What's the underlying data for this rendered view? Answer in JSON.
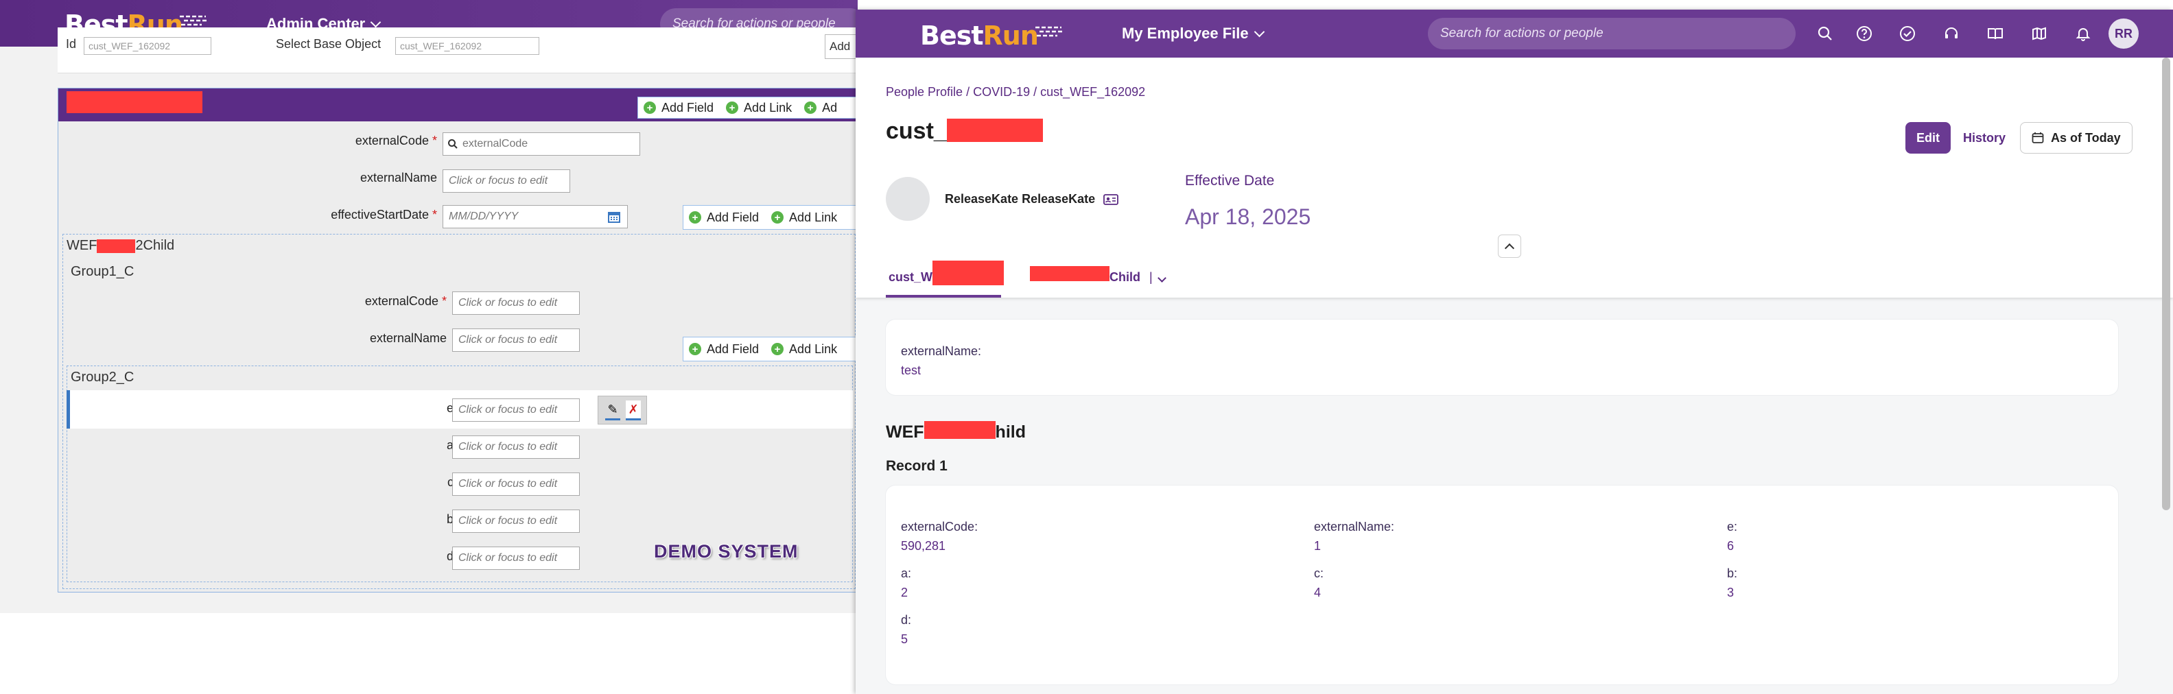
{
  "left": {
    "brand": {
      "best": "Best",
      "run": "Run"
    },
    "shell_title": "Admin Center",
    "search_placeholder": "Search for actions or people",
    "top_label_id": "Id",
    "top_label_base": "Select Base Object",
    "top_id_value": "cust_WEF_162092",
    "top_base_value": "cust_WEF_162092",
    "top_cut_button": "Add",
    "toolbar1": {
      "add_field": "Add Field",
      "add_link": "Add Link",
      "add_cut": "Ad"
    },
    "fields_top": [
      {
        "label": "externalCode",
        "required": true,
        "placeholder": "externalCode"
      },
      {
        "label": "externalName",
        "required": false,
        "placeholder": "Click or focus to edit"
      },
      {
        "label": "effectiveStartDate",
        "required": true,
        "placeholder": "MM/DD/YYYY"
      }
    ],
    "toolbar2": {
      "add_field": "Add Field",
      "add_link": "Add Link"
    },
    "child_section": {
      "prefix": "WEF",
      "suffix": "2Child"
    },
    "group1": "Group1_C",
    "group1_fields": [
      {
        "label": "externalCode",
        "required": true,
        "placeholder": "Click or focus to edit"
      },
      {
        "label": "externalName",
        "required": false,
        "placeholder": "Click or focus to edit"
      }
    ],
    "toolbar3": {
      "add_field": "Add Field",
      "add_link": "Add Link"
    },
    "group2": "Group2_C",
    "group2_fields": [
      {
        "label": "e",
        "placeholder": "Click or focus to edit"
      },
      {
        "label": "a",
        "placeholder": "Click or focus to edit"
      },
      {
        "label": "c",
        "placeholder": "Click or focus to edit"
      },
      {
        "label": "b",
        "placeholder": "Click or focus to edit"
      },
      {
        "label": "d",
        "placeholder": "Click or focus to edit"
      }
    ],
    "demo_system": "DEMO SYSTEM"
  },
  "right": {
    "brand": {
      "best": "Best",
      "run": "Run"
    },
    "shell_title": "My Employee File",
    "search_placeholder": "Search for actions or people",
    "avatar_initials": "RR",
    "breadcrumb": "People Profile / COVID-19 / cust_WEF_162092",
    "title_prefix": "cust_",
    "edit": "Edit",
    "history": "History",
    "as_of_today": "As of Today",
    "person_name": "ReleaseKate ReleaseKate",
    "effective_date_label": "Effective Date",
    "effective_date_value": "Apr 18, 2025",
    "tab1_prefix": "cust_W",
    "tab2_suffix": "Child",
    "tab_more": "|",
    "external_name_label": "externalName:",
    "external_name_value": "test",
    "child_head_prefix": "WEF",
    "child_head_suffix": "hild",
    "record_title": "Record 1",
    "record": [
      {
        "label": "externalCode:",
        "value": "590,281"
      },
      {
        "label": "externalName:",
        "value": "1"
      },
      {
        "label": "e:",
        "value": "6"
      },
      {
        "label": "a:",
        "value": "2"
      },
      {
        "label": "c:",
        "value": "4"
      },
      {
        "label": "b:",
        "value": "3"
      },
      {
        "label": "d:",
        "value": "5"
      }
    ]
  },
  "colors": {
    "brand_purple": "#6a3a92",
    "brand_orange": "#f2a12a",
    "redaction": "#ff3b3b"
  }
}
